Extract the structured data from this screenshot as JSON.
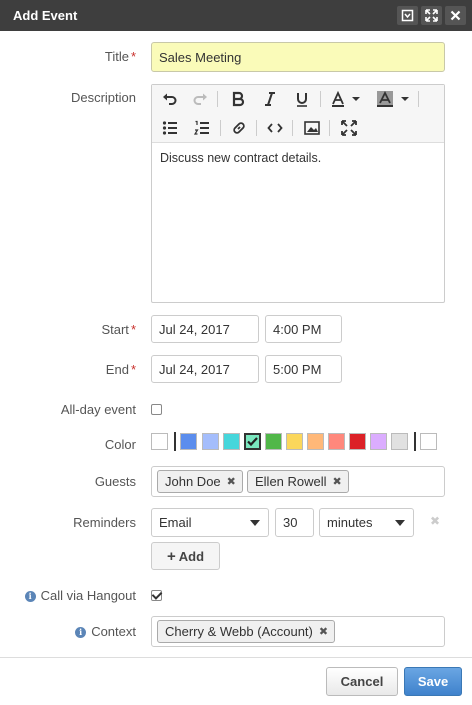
{
  "dialog": {
    "title": "Add Event",
    "buttons": [
      "minimize-icon",
      "maximize-icon",
      "close-icon"
    ]
  },
  "form": {
    "title_label": "Title",
    "title_value": "Sales Meeting",
    "description_label": "Description",
    "description_text": "Discuss new contract details.",
    "start_label": "Start",
    "start_date": "Jul 24, 2017",
    "start_time": "4:00 PM",
    "end_label": "End",
    "end_date": "Jul 24, 2017",
    "end_time": "5:00 PM",
    "allday_label": "All-day event",
    "allday_checked": false,
    "color_label": "Color",
    "colors": [
      "#ffffff",
      "#5b8ded",
      "#a4bdfc",
      "#46d6db",
      "#7ae7bf",
      "#51b749",
      "#fbd75b",
      "#ffb878",
      "#ff887c",
      "#dc2127",
      "#dbadff",
      "#e1e1e1",
      "#ffffff"
    ],
    "selected_color": "#7ae7bf",
    "guests_label": "Guests",
    "guests": [
      "John Doe",
      "Ellen Rowell"
    ],
    "reminders_label": "Reminders",
    "reminder_method": "Email",
    "reminder_amount": "30",
    "reminder_unit": "minutes",
    "add_label": "Add",
    "hangout_label": "Call via Hangout",
    "hangout_checked": true,
    "context_label": "Context",
    "contexts": [
      "Cherry & Webb (Account)"
    ]
  },
  "footer": {
    "cancel_label": "Cancel",
    "save_label": "Save"
  }
}
